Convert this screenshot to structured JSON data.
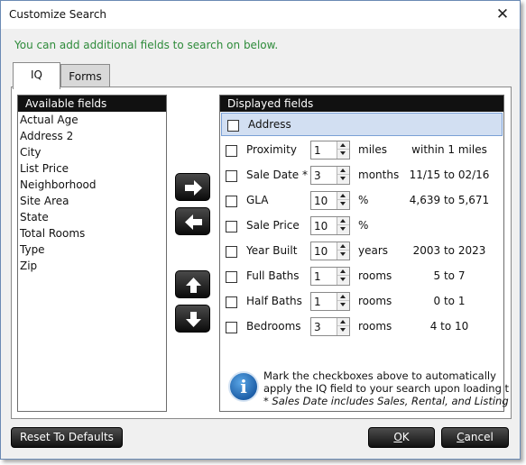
{
  "window": {
    "title": "Customize Search",
    "close_glyph": "✕"
  },
  "hint": "You can add additional fields to search on below.",
  "tabs": [
    {
      "label": "IQ"
    },
    {
      "label": "Forms"
    }
  ],
  "available": {
    "header": "Available fields",
    "items": [
      "Actual Age",
      "Address 2",
      "City",
      "List Price",
      "Neighborhood",
      "Site Area",
      "State",
      "Total Rooms",
      "Type",
      "Zip"
    ]
  },
  "displayed": {
    "header": "Displayed fields",
    "rows": [
      {
        "name": "Address",
        "checked": false,
        "selected": true
      },
      {
        "name": "Proximity",
        "checked": false,
        "value": "1",
        "unit": "miles",
        "range": "within 1 miles"
      },
      {
        "name": "Sale Date *",
        "checked": false,
        "value": "3",
        "unit": "months",
        "range": "11/15 to 02/16"
      },
      {
        "name": "GLA",
        "checked": false,
        "value": "10",
        "unit": "%",
        "range": "4,639 to 5,671"
      },
      {
        "name": "Sale Price",
        "checked": false,
        "value": "10",
        "unit": "%",
        "range": ""
      },
      {
        "name": "Year Built",
        "checked": false,
        "value": "10",
        "unit": "years",
        "range": "2003 to 2023"
      },
      {
        "name": "Full Baths",
        "checked": false,
        "value": "1",
        "unit": "rooms",
        "range": "5 to 7"
      },
      {
        "name": "Half Baths",
        "checked": false,
        "value": "1",
        "unit": "rooms",
        "range": "0 to 1"
      },
      {
        "name": "Bedrooms",
        "checked": false,
        "value": "3",
        "unit": "rooms",
        "range": "4 to 10"
      }
    ],
    "note_line1": "Mark the checkboxes above to automatically",
    "note_line2": "apply the IQ field to your search upon loading t",
    "note_line3": "* Sales Date includes Sales, Rental, and Listing",
    "info_glyph": "i"
  },
  "buttons": {
    "reset": "Reset To Defaults",
    "ok_mnemonic": "O",
    "ok_rest": "K",
    "cancel_mnemonic": "C",
    "cancel_rest": "ancel"
  },
  "icons": [
    "right-arrow-icon",
    "left-arrow-icon",
    "up-arrow-icon",
    "down-arrow-icon",
    "info-icon",
    "close-icon"
  ]
}
